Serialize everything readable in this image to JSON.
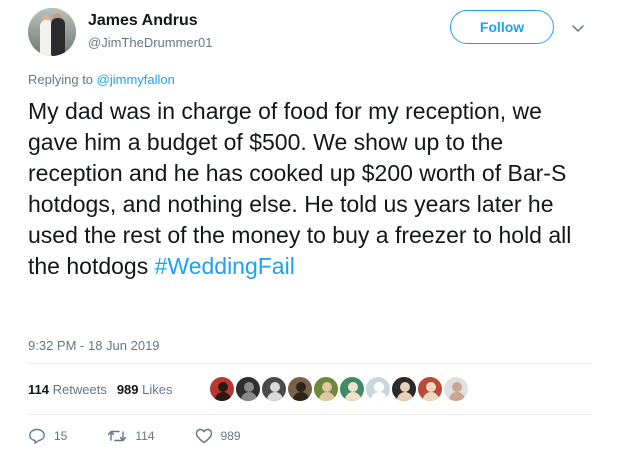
{
  "user": {
    "name": "James Andrus",
    "handle": "@JimTheDrummer01",
    "follow_label": "Follow"
  },
  "reply": {
    "prefix": "Replying to ",
    "mention": "@jimmyfallon"
  },
  "tweet": {
    "text": "My dad was in charge of food for my reception, we gave him a budget of $500. We show up to the reception and he has cooked up $200 worth of Bar-S hotdogs, and nothing else. He told us years later he used the rest of the money to buy a freezer to hold all the hotdogs ",
    "hashtag": "#WeddingFail",
    "timestamp": "9:32 PM - 18 Jun 2019"
  },
  "stats": {
    "retweets_count": "114",
    "retweets_label": "Retweets",
    "likes_count": "989",
    "likes_label": "Likes"
  },
  "actions": {
    "reply_count": "15",
    "retweet_count": "114",
    "like_count": "989"
  },
  "liker_avatars": [
    {
      "bg": "#b83a2e",
      "fg": "#2a1a14"
    },
    {
      "bg": "#2e2e2e",
      "fg": "#8a8a8a"
    },
    {
      "bg": "#4a4a4a",
      "fg": "#d8d8d8"
    },
    {
      "bg": "#7a6248",
      "fg": "#2c2418"
    },
    {
      "bg": "#6b8a3e",
      "fg": "#e0c8a0"
    },
    {
      "bg": "#3f8a6b",
      "fg": "#f0e0c8"
    },
    {
      "bg": "#ccd6dd",
      "fg": "#ffffff"
    },
    {
      "bg": "#2a2a2a",
      "fg": "#e8d0b8"
    },
    {
      "bg": "#b84a3a",
      "fg": "#f0d8c0"
    },
    {
      "bg": "#e0e0e0",
      "fg": "#c8a890"
    }
  ],
  "colors": {
    "accent": "#1da1f2",
    "muted": "#657786",
    "text": "#14171a"
  }
}
